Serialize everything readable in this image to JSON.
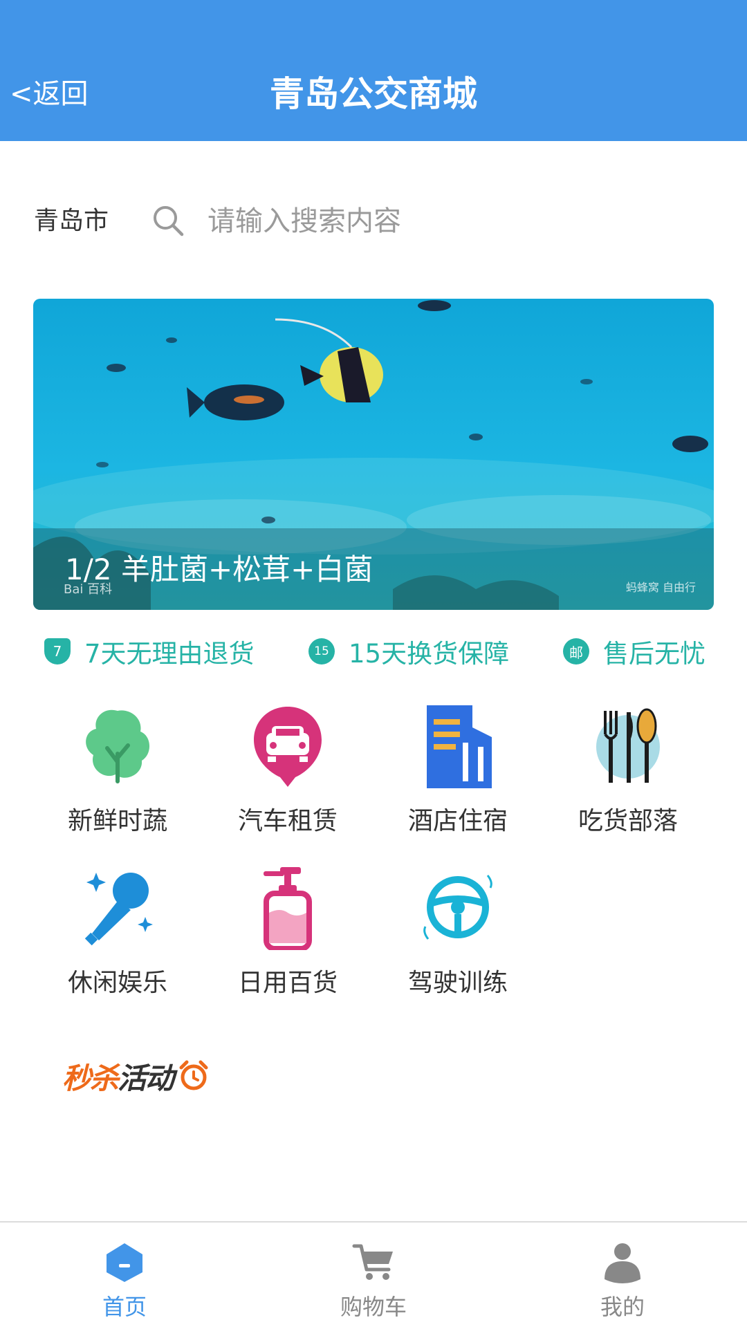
{
  "header": {
    "back_label": "<返回",
    "title": "青岛公交商城"
  },
  "search": {
    "city": "青岛市",
    "placeholder": "请输入搜索内容",
    "value": ""
  },
  "banner": {
    "caption": "1/2 羊肚菌+松茸+白菌",
    "watermark_left": "Bai 百科",
    "watermark_right": "蚂蜂窝  自由行"
  },
  "guarantees": [
    {
      "icon": "shield-7-icon",
      "badge": "7",
      "text": "7天无理由退货"
    },
    {
      "icon": "clock-15-icon",
      "badge": "15",
      "text": "15天换货保障"
    },
    {
      "icon": "mail-icon",
      "badge": "邮",
      "text": "售后无忧"
    }
  ],
  "categories": [
    {
      "label": "新鲜时蔬",
      "icon": "vegetable-icon",
      "color": "#5dc98a"
    },
    {
      "label": "汽车租赁",
      "icon": "car-rental-icon",
      "color": "#d6337a"
    },
    {
      "label": "酒店住宿",
      "icon": "hotel-icon",
      "color": "#2f6fe0"
    },
    {
      "label": "吃货部落",
      "icon": "food-icon",
      "color": "#e8a93a"
    },
    {
      "label": "休闲娱乐",
      "icon": "microphone-icon",
      "color": "#1e8ed8"
    },
    {
      "label": "日用百货",
      "icon": "lotion-bottle-icon",
      "color": "#d6337a"
    },
    {
      "label": "驾驶训练",
      "icon": "steering-wheel-icon",
      "color": "#1ab3d6"
    }
  ],
  "flash_sale": {
    "part1": "秒杀",
    "part2": "活动",
    "icon": "alarm-clock-icon"
  },
  "tabbar": [
    {
      "label": "首页",
      "icon": "home-icon",
      "active": true
    },
    {
      "label": "购物车",
      "icon": "cart-icon",
      "active": false
    },
    {
      "label": "我的",
      "icon": "user-icon",
      "active": false
    }
  ],
  "colors": {
    "primary": "#4295e8",
    "accent": "#26b3a6",
    "inactive": "#888888",
    "flash": "#ee6a1a"
  }
}
